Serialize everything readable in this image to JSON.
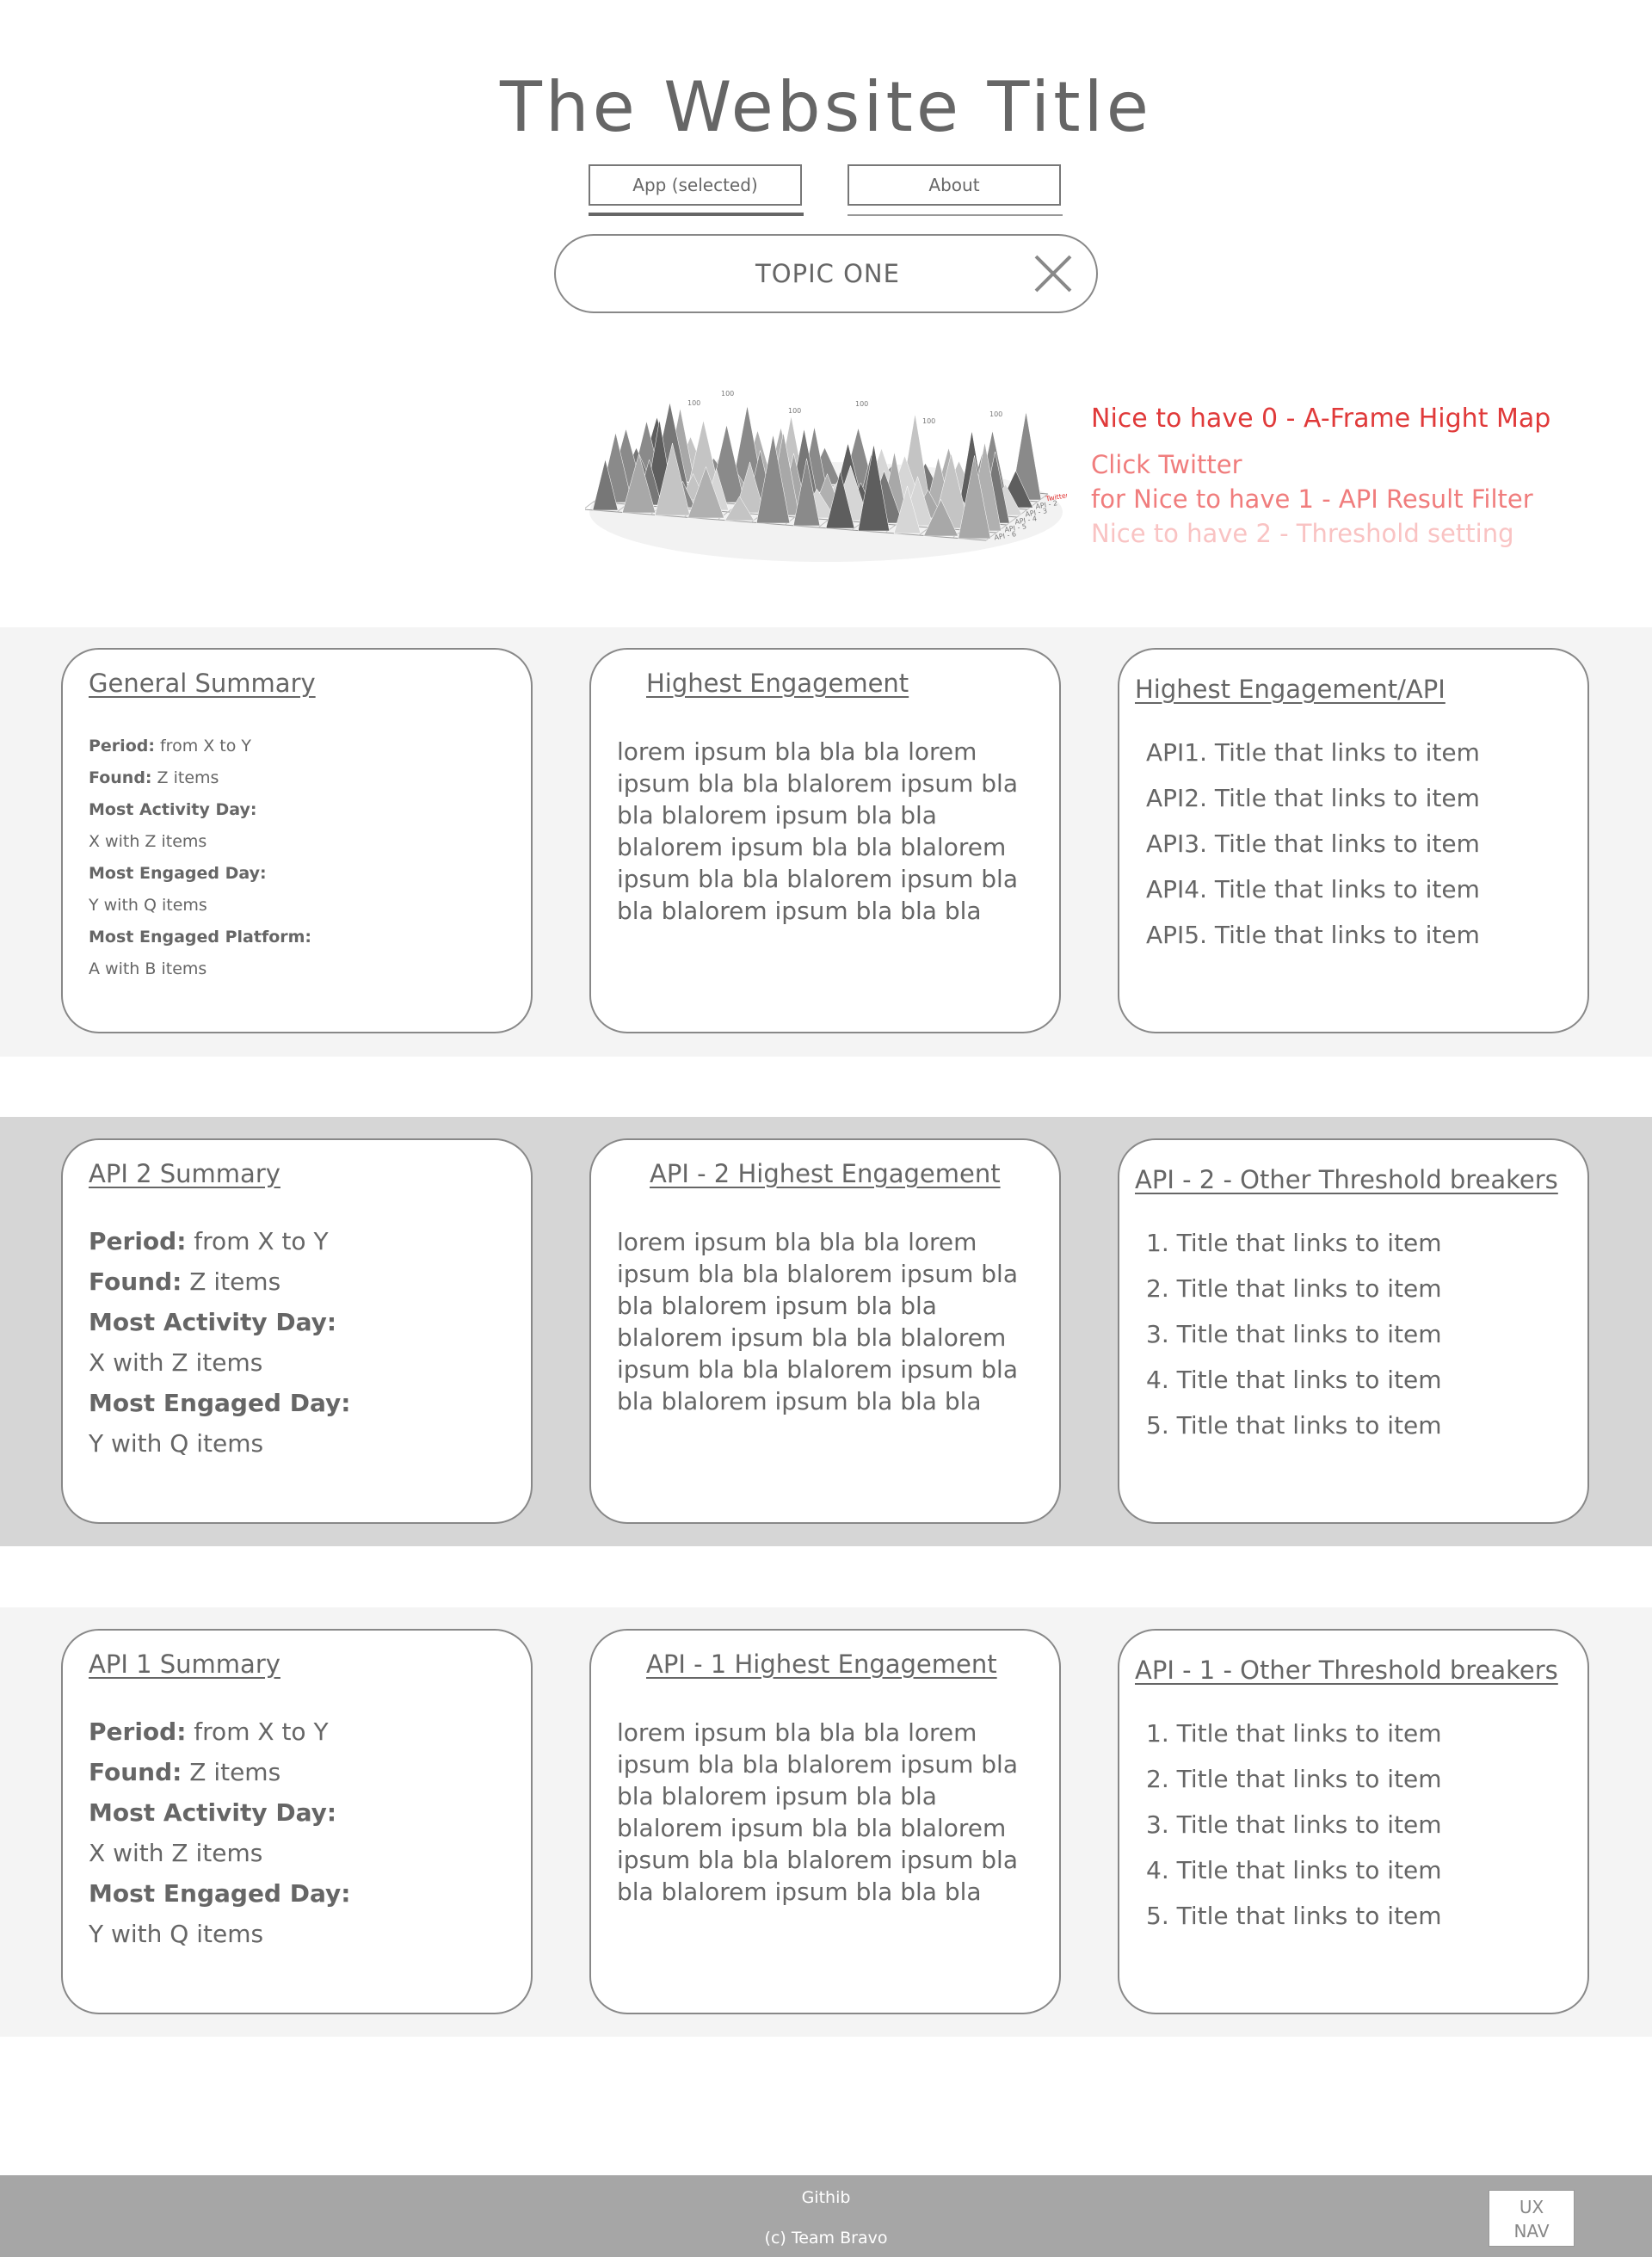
{
  "header": {
    "title": "The Website Title",
    "tabs": [
      {
        "label": "App (selected)"
      },
      {
        "label": "About"
      }
    ],
    "topic": {
      "label": "TOPIC ONE"
    }
  },
  "heightmap": {
    "peak_labels": [
      "100",
      "100",
      "100",
      "100",
      "100",
      "100"
    ],
    "row_labels": [
      "Twitter",
      "API - 2",
      "API - 3",
      "API - 4",
      "API - 5",
      "API - 6"
    ],
    "accent_color": "#e03030"
  },
  "notes": {
    "nice0": "Nice to have 0 - A-Frame Hight Map",
    "nice1_line1": "Click Twitter",
    "nice1_line2": "for Nice to have 1 - API Result Filter",
    "nice2": "Nice to have 2 - Threshold setting",
    "colors": {
      "nice0": "#e03a3a",
      "nice1": "#f07d7d",
      "nice2": "#f9c3c3"
    }
  },
  "general": {
    "summary": {
      "title": "General Summary",
      "period_label": "Period:",
      "period_value": " from X to Y",
      "found_label": "Found:",
      "found_value": " Z items",
      "activity_label": "Most Activity Day:",
      "activity_value": "X with Z items",
      "engaged_label": "Most Engaged Day:",
      "engaged_value": "Y with Q items",
      "platform_label": "Most Engaged Platform:",
      "platform_value": "A with B items"
    },
    "engagement": {
      "title": "Highest Engagement ",
      "body": "lorem ipsum bla bla bla lorem ipsum bla bla blalorem ipsum bla bla blalorem ipsum bla bla blalorem ipsum bla bla blalorem ipsum bla bla blalorem ipsum bla bla blalorem ipsum bla bla bla"
    },
    "per_api": {
      "title": "Highest Engagement/API",
      "items": [
        "API1. Title that links to item",
        "API2. Title that links to item",
        "API3. Title that links to item",
        "API4. Title that links to item",
        "API5. Title that links to item"
      ]
    }
  },
  "api2": {
    "summary": {
      "title": "API 2 Summary",
      "period_label": "Period:",
      "period_value": " from X to Y",
      "found_label": "Found:",
      "found_value": " Z items",
      "activity_label": "Most Activity Day:",
      "activity_value": "X with Z items",
      "engaged_label": "Most Engaged Day:",
      "engaged_value": "Y with Q items"
    },
    "engagement": {
      "title": "API - 2 Highest Engagement",
      "body": "lorem ipsum bla bla bla lorem ipsum bla bla blalorem ipsum bla bla blalorem ipsum bla bla blalorem ipsum bla bla blalorem ipsum bla bla blalorem ipsum bla bla blalorem ipsum bla bla bla"
    },
    "threshold": {
      "title": "API - 2 - Other Threshold  breakers",
      "items": [
        "1. Title that links to item",
        "2. Title that links to item",
        "3. Title that links to item",
        "4. Title that links to item",
        "5. Title that links to item"
      ]
    }
  },
  "api1": {
    "summary": {
      "title": "API 1 Summary",
      "period_label": "Period:",
      "period_value": " from X to Y",
      "found_label": "Found:",
      "found_value": " Z items",
      "activity_label": "Most Activity Day:",
      "activity_value": "X with Z items",
      "engaged_label": "Most Engaged Day:",
      "engaged_value": "Y with Q items"
    },
    "engagement": {
      "title": "API - 1 Highest Engagement ",
      "body": "lorem ipsum bla bla bla lorem ipsum bla bla blalorem ipsum bla bla blalorem ipsum bla bla blalorem ipsum bla bla blalorem ipsum bla bla blalorem ipsum bla bla blalorem ipsum bla bla bla"
    },
    "threshold": {
      "title": "API - 1 - Other Threshold  breakers",
      "items": [
        "1. Title that links to item",
        "2. Title that links to item",
        "3. Title that links to item",
        "4. Title that links to item",
        "5. Title that links to item"
      ]
    }
  },
  "colors": {
    "band_light": "#f4f4f4",
    "band_dark": "#d6d6d6",
    "footer": "#a6a6a6"
  },
  "footer": {
    "github": "Githib",
    "copyright": "(c) Team Bravo",
    "ux_nav_line1": "UX",
    "ux_nav_line2": "NAV"
  }
}
